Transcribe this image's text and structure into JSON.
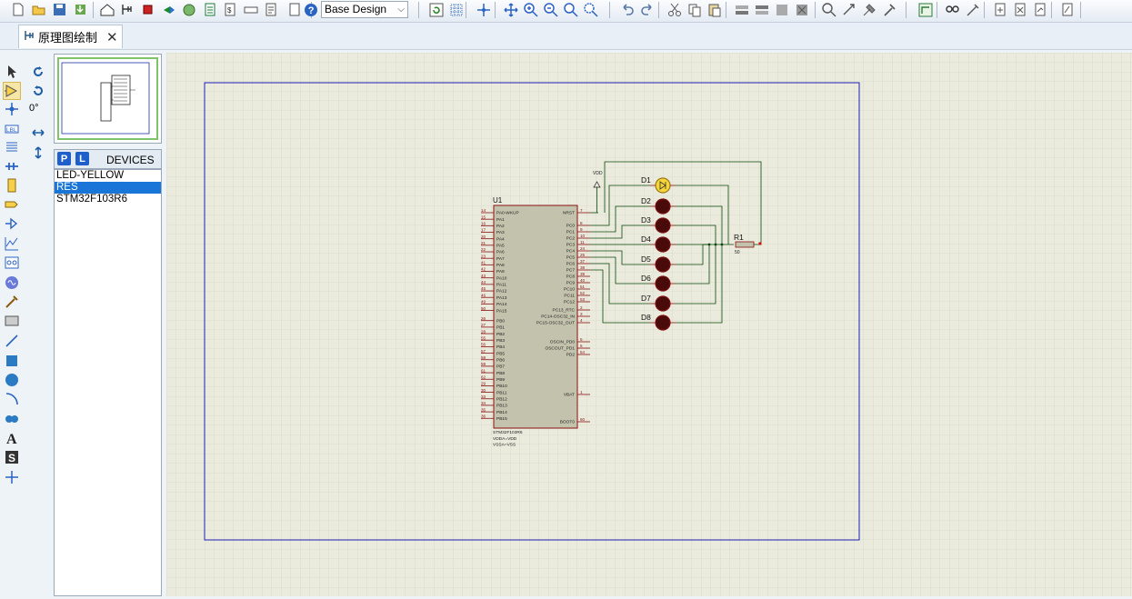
{
  "toolbar": {
    "design_select": "Base Design",
    "buttons": [
      "new-file-icon",
      "open-folder-icon",
      "save-icon",
      "import-icon",
      "home-icon",
      "schematic-icon",
      "pcb-icon",
      "3d-viewer-icon",
      "gerber-icon",
      "bom-icon",
      "design-explorer-icon",
      "cost-icon",
      "netlist-icon",
      "notes-icon",
      "help-icon",
      "refresh-icon",
      "grid-icon",
      "origin-icon",
      "pan-icon",
      "zoom-in-icon",
      "zoom-out-icon",
      "zoom-all-icon",
      "zoom-area-icon",
      "undo-icon",
      "redo-icon",
      "cut-icon",
      "copy-icon",
      "paste-icon",
      "block-copy-icon",
      "block-move-icon",
      "block-rotate-icon",
      "block-delete-icon",
      "pick-device-icon",
      "make-device-icon",
      "package-tool-icon",
      "decompose-icon",
      "wire-autorouter-icon",
      "search-icon",
      "property-tool-icon",
      "new-sheet-icon",
      "delete-sheet-icon",
      "goto-sheet-icon",
      "design-notes-icon"
    ]
  },
  "tab": {
    "label": "原理图绘制",
    "icon": "schematic-icon"
  },
  "left_tools": [
    "selection-icon",
    "component-icon",
    "junction-icon",
    "wire-label-icon",
    "text-script-icon",
    "bus-icon",
    "subcircuit-icon",
    "terminals-icon",
    "device-pins-icon",
    "graph-icon",
    "tape-recorder-icon",
    "generator-icon",
    "voltage-probe-icon",
    "current-probe-icon",
    "line-icon",
    "box-icon",
    "circle-icon",
    "arc-icon",
    "path-icon",
    "text-icon",
    "symbol-icon",
    "marker-icon"
  ],
  "rotation": {
    "angle": "0°"
  },
  "devices": {
    "p_label": "P",
    "l_label": "L",
    "title": "DEVICES",
    "items": [
      "LED-YELLOW",
      "RES",
      "STM32F103R6"
    ],
    "selected": "RES"
  },
  "schematic": {
    "chip": {
      "ref": "U1",
      "part": "STM32F103R6",
      "notes": [
        "VDDA=VDD",
        "VSSA=VSS"
      ],
      "left_pins": [
        {
          "num": "14",
          "name": "PA0-WKUP"
        },
        {
          "num": "15",
          "name": "PA1"
        },
        {
          "num": "16",
          "name": "PA2"
        },
        {
          "num": "17",
          "name": "PA3"
        },
        {
          "num": "20",
          "name": "PA4"
        },
        {
          "num": "21",
          "name": "PA5"
        },
        {
          "num": "22",
          "name": "PA6"
        },
        {
          "num": "23",
          "name": "PA7"
        },
        {
          "num": "41",
          "name": "PA8"
        },
        {
          "num": "42",
          "name": "PA9"
        },
        {
          "num": "43",
          "name": "PA10"
        },
        {
          "num": "44",
          "name": "PA11"
        },
        {
          "num": "45",
          "name": "PA12"
        },
        {
          "num": "46",
          "name": "PA13"
        },
        {
          "num": "49",
          "name": "PA14"
        },
        {
          "num": "50",
          "name": "PA15"
        },
        {
          "num": "26",
          "name": "PB0"
        },
        {
          "num": "27",
          "name": "PB1"
        },
        {
          "num": "28",
          "name": "PB2"
        },
        {
          "num": "55",
          "name": "PB3"
        },
        {
          "num": "56",
          "name": "PB4"
        },
        {
          "num": "57",
          "name": "PB5"
        },
        {
          "num": "58",
          "name": "PB6"
        },
        {
          "num": "59",
          "name": "PB7"
        },
        {
          "num": "61",
          "name": "PB8"
        },
        {
          "num": "62",
          "name": "PB9"
        },
        {
          "num": "29",
          "name": "PB10"
        },
        {
          "num": "30",
          "name": "PB11"
        },
        {
          "num": "33",
          "name": "PB12"
        },
        {
          "num": "34",
          "name": "PB13"
        },
        {
          "num": "35",
          "name": "PB14"
        },
        {
          "num": "36",
          "name": "PB15"
        }
      ],
      "right_pins": [
        {
          "num": "7",
          "name": "NRST"
        },
        {
          "num": "8",
          "name": "PC0"
        },
        {
          "num": "9",
          "name": "PC1"
        },
        {
          "num": "10",
          "name": "PC2"
        },
        {
          "num": "11",
          "name": "PC3"
        },
        {
          "num": "24",
          "name": "PC4"
        },
        {
          "num": "25",
          "name": "PC5"
        },
        {
          "num": "37",
          "name": "PC6"
        },
        {
          "num": "38",
          "name": "PC7"
        },
        {
          "num": "39",
          "name": "PC8"
        },
        {
          "num": "40",
          "name": "PC9"
        },
        {
          "num": "51",
          "name": "PC10"
        },
        {
          "num": "52",
          "name": "PC11"
        },
        {
          "num": "53",
          "name": "PC12"
        },
        {
          "num": "2",
          "name": "PC13_RTC"
        },
        {
          "num": "3",
          "name": "PC14-OSC32_IN"
        },
        {
          "num": "4",
          "name": "PC15-OSC32_OUT"
        },
        {
          "num": "5",
          "name": "OSCIN_PD0"
        },
        {
          "num": "6",
          "name": "OSCOUT_PD1"
        },
        {
          "num": "54",
          "name": "PD2"
        },
        {
          "num": "1",
          "name": "VBAT"
        },
        {
          "num": "60",
          "name": "BOOT0"
        }
      ]
    },
    "power_label": "VDD",
    "leds": [
      "D1",
      "D2",
      "D3",
      "D4",
      "D5",
      "D6",
      "D7",
      "D8"
    ],
    "resistor": {
      "ref": "R1",
      "value": "50"
    }
  }
}
